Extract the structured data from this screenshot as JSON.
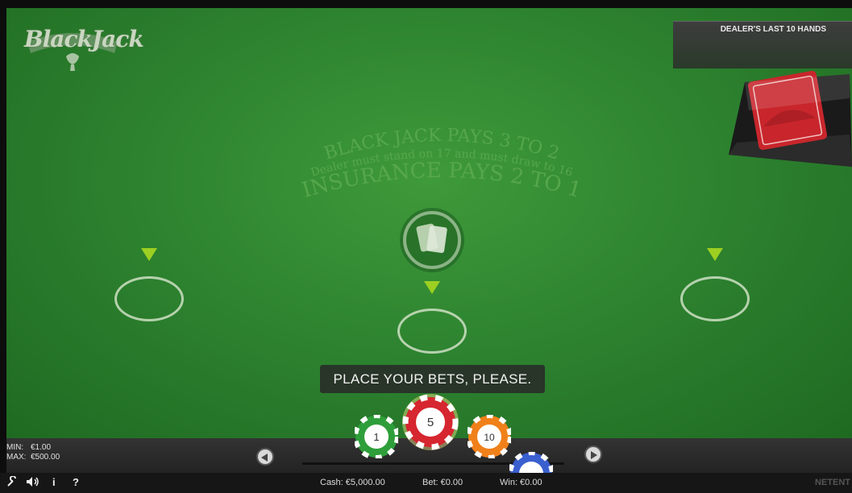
{
  "logo": {
    "text": "BlackJack"
  },
  "table_text": {
    "line1": "BLACK JACK PAYS 3 TO 2",
    "line2": "Dealer must stand on 17 and must draw to 16",
    "line3": "INSURANCE PAYS 2 TO 1"
  },
  "history": {
    "title": "DEALER'S LAST 10 HANDS"
  },
  "message": "PLACE YOUR BETS, PLEASE.",
  "limits": {
    "min_label": "MIN:",
    "min_value": "€1.00",
    "max_label": "MAX:",
    "max_value": "€500.00"
  },
  "chips": [
    {
      "value": "1",
      "color": "#2e9e3a"
    },
    {
      "value": "5",
      "color": "#d6262f",
      "selected": true
    },
    {
      "value": "10",
      "color": "#f0801a"
    },
    {
      "value": "",
      "color": "#3a5fcf"
    }
  ],
  "status": {
    "cash": "Cash: €5,000.00",
    "bet": "Bet: €0.00",
    "win": "Win: €0.00",
    "brand": "NETENT"
  },
  "tools": {
    "settings_icon": "wrench-icon",
    "sound_icon": "speaker-icon",
    "info": "i",
    "help": "?"
  },
  "colors": {
    "felt": "#2e8430",
    "arrow": "#9ccf21"
  }
}
